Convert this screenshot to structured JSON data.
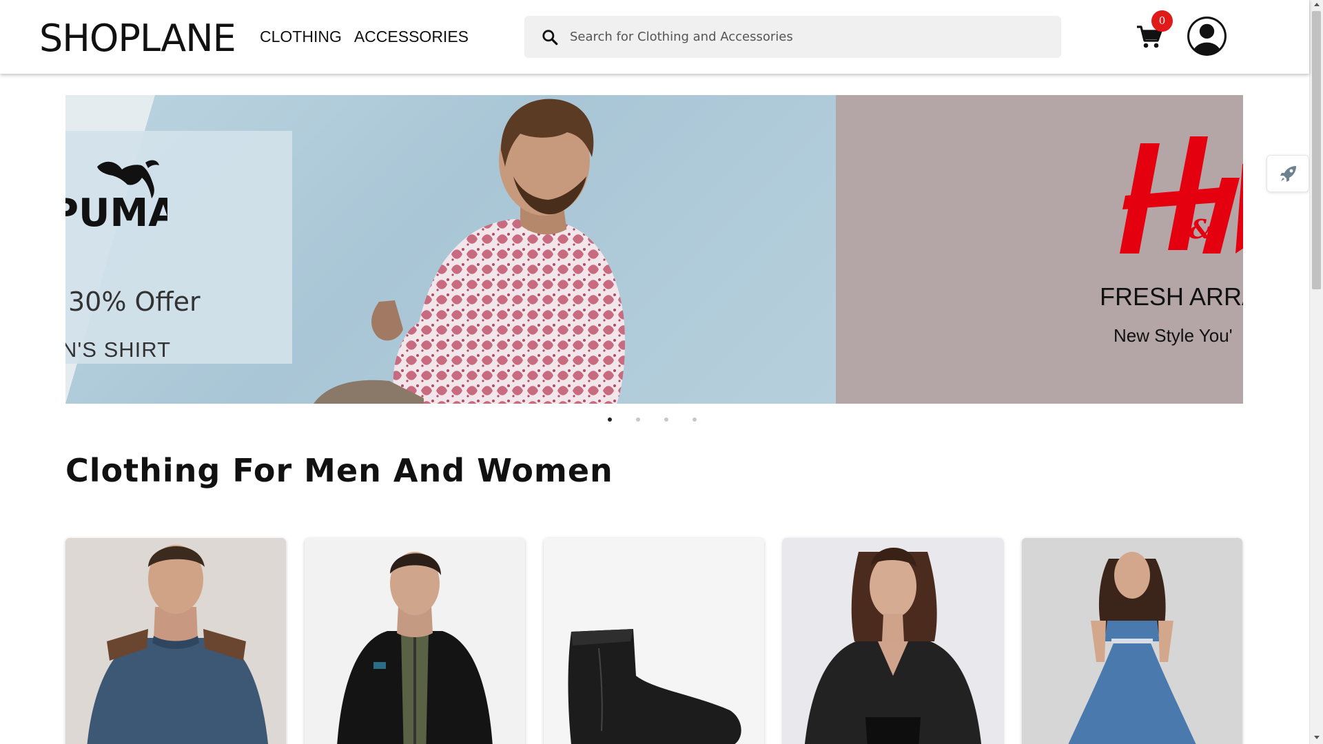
{
  "header": {
    "logo": "SHOPLANE",
    "nav": [
      "CLOTHING",
      "ACCESSORIES"
    ],
    "search_placeholder": "Search for Clothing and Accessories",
    "cart_count": "0",
    "icons": {
      "search": "search-icon",
      "cart": "cart-icon",
      "account": "user-account-icon"
    }
  },
  "carousel": {
    "slides": [
      {
        "brand": "PUMA",
        "offer": "30% Offer",
        "subtitle": "N'S SHIRT"
      },
      {
        "brand": "H&M",
        "headline": "FRESH ARRA",
        "tagline": "New Style You'"
      }
    ],
    "dot_count": 4,
    "active_dot": 1
  },
  "side_widget": {
    "icon": "rocket-icon"
  },
  "section": {
    "title": "Clothing For Men And Women"
  },
  "products": [
    {
      "name": "sweater",
      "image": "man-in-blue-sweater"
    },
    {
      "name": "jacket",
      "image": "man-in-black-jacket"
    },
    {
      "name": "boots",
      "image": "black-leather-boot"
    },
    {
      "name": "leather-jacket",
      "image": "woman-in-leather-jacket"
    },
    {
      "name": "dress",
      "image": "woman-in-blue-denim-dress"
    }
  ],
  "colors": {
    "badge": "#e01919",
    "slide1_bg": "#b6cfdc",
    "slide2_bg": "#b4a6a7",
    "hm_red": "#e50010"
  }
}
